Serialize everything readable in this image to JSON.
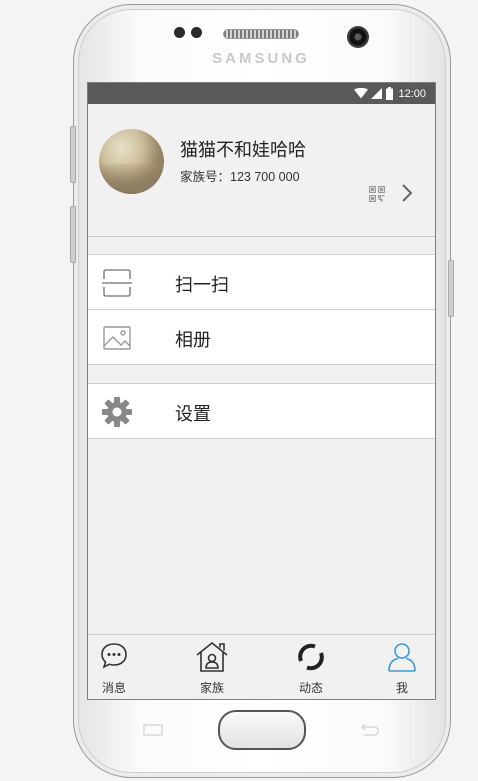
{
  "device": {
    "brand": "SAMSUNG"
  },
  "status_bar": {
    "time": "12:00"
  },
  "profile": {
    "name": "猫猫不和娃哈哈",
    "family_id_label": "家族号：",
    "family_id": "123 700 000"
  },
  "menu": {
    "scan": {
      "label": "扫一扫",
      "icon": "scan-icon"
    },
    "album": {
      "label": "相册",
      "icon": "image-icon"
    },
    "settings": {
      "label": "设置",
      "icon": "gear-icon"
    }
  },
  "tabs": [
    {
      "label": "消息",
      "icon": "chat-bubble-icon"
    },
    {
      "label": "家族",
      "icon": "home-icon"
    },
    {
      "label": "动态",
      "icon": "refresh-icon"
    },
    {
      "label": "我",
      "icon": "user-icon",
      "active": true
    }
  ],
  "colors": {
    "accent": "#3a9ad9",
    "status_bar": "#595959",
    "screen_bg": "#f1f1f1"
  }
}
